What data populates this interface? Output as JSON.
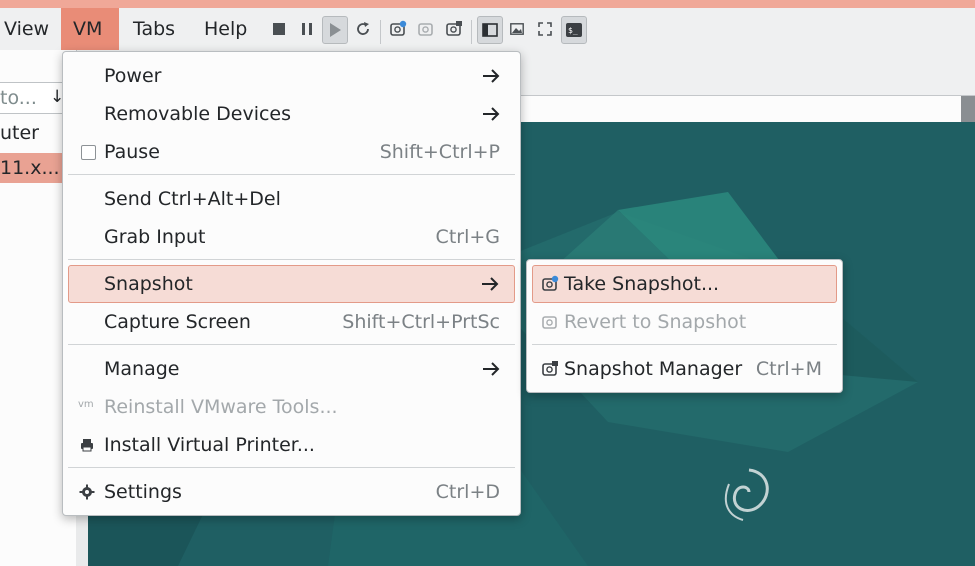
{
  "menubar": {
    "items": [
      {
        "label": "View"
      },
      {
        "label": "VM"
      },
      {
        "label": "Tabs"
      },
      {
        "label": "Help"
      }
    ]
  },
  "toolbar": {
    "buttons": [
      "stop-icon",
      "pause-icon",
      "play-icon",
      "restart-icon",
      "take-snapshot-icon",
      "revert-snapshot-icon",
      "snapshot-manager-icon",
      "sidebar-toggle-icon",
      "thumbnail-icon",
      "fullscreen-icon",
      "console-view-icon"
    ]
  },
  "sidebar": {
    "filter_text": "to...",
    "sort_glyph": "↓",
    "rows": [
      {
        "label": "uter"
      },
      {
        "label": "11.x..."
      }
    ]
  },
  "vm_menu": {
    "items": [
      {
        "label": "Power",
        "has_submenu": true
      },
      {
        "label": "Removable Devices",
        "has_submenu": true
      },
      {
        "label": "Pause",
        "shortcut": "Shift+Ctrl+P",
        "checkbox": false
      },
      {
        "label": "Send Ctrl+Alt+Del"
      },
      {
        "label": "Grab Input",
        "shortcut": "Ctrl+G"
      },
      {
        "label": "Snapshot",
        "has_submenu": true,
        "highlighted": true
      },
      {
        "label": "Capture Screen",
        "shortcut": "Shift+Ctrl+PrtSc"
      },
      {
        "label": "Manage",
        "has_submenu": true
      },
      {
        "label": "Reinstall VMware Tools...",
        "disabled": true,
        "icon": "vm"
      },
      {
        "label": "Install Virtual Printer...",
        "icon": "printer-icon"
      },
      {
        "label": "Settings",
        "shortcut": "Ctrl+D",
        "icon": "gear-icon"
      }
    ]
  },
  "snapshot_menu": {
    "items": [
      {
        "label": "Take Snapshot...",
        "highlighted": true,
        "icon": "take-snapshot-icon"
      },
      {
        "label": "Revert to Snapshot",
        "disabled": true,
        "icon": "revert-snapshot-icon"
      },
      {
        "label": "Snapshot Manager",
        "shortcut": "Ctrl+M",
        "icon": "snapshot-manager-icon"
      }
    ]
  },
  "colors": {
    "accent": "#e98c77",
    "highlight_bg": "#f6dcd6",
    "desktop_bg": "#1f5f63"
  }
}
